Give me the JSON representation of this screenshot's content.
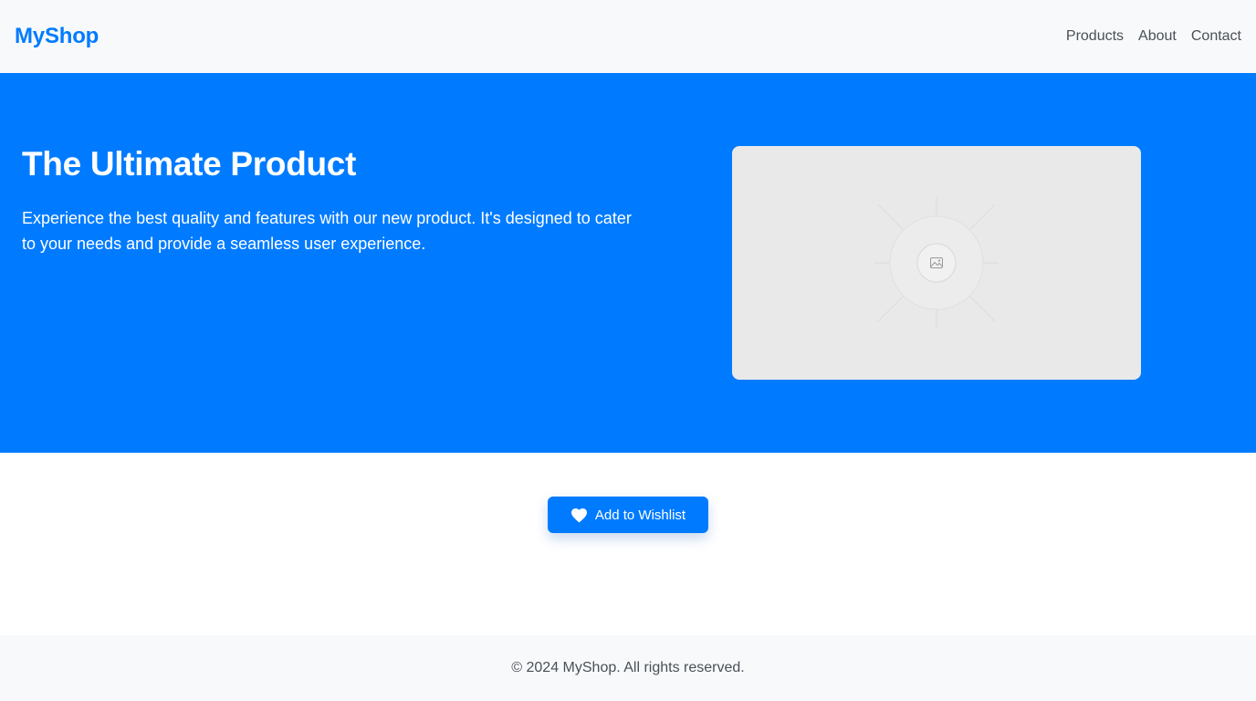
{
  "header": {
    "logo": "MyShop",
    "nav": [
      {
        "label": "Products"
      },
      {
        "label": "About"
      },
      {
        "label": "Contact"
      }
    ]
  },
  "hero": {
    "title": "The Ultimate Product",
    "description": "Experience the best quality and features with our new product. It's designed to cater to your needs and provide a seamless user experience.",
    "image_icon": "image-placeholder-icon"
  },
  "main": {
    "wishlist_button": {
      "label": "Add to Wishlist",
      "icon": "heart-icon"
    }
  },
  "footer": {
    "copyright": "© 2024 MyShop. All rights reserved."
  },
  "colors": {
    "primary": "#007bff",
    "header_bg": "#f8f9fa",
    "footer_bg": "#f8f9fa",
    "text_muted": "#495057",
    "placeholder_bg": "#e9e9e9"
  }
}
